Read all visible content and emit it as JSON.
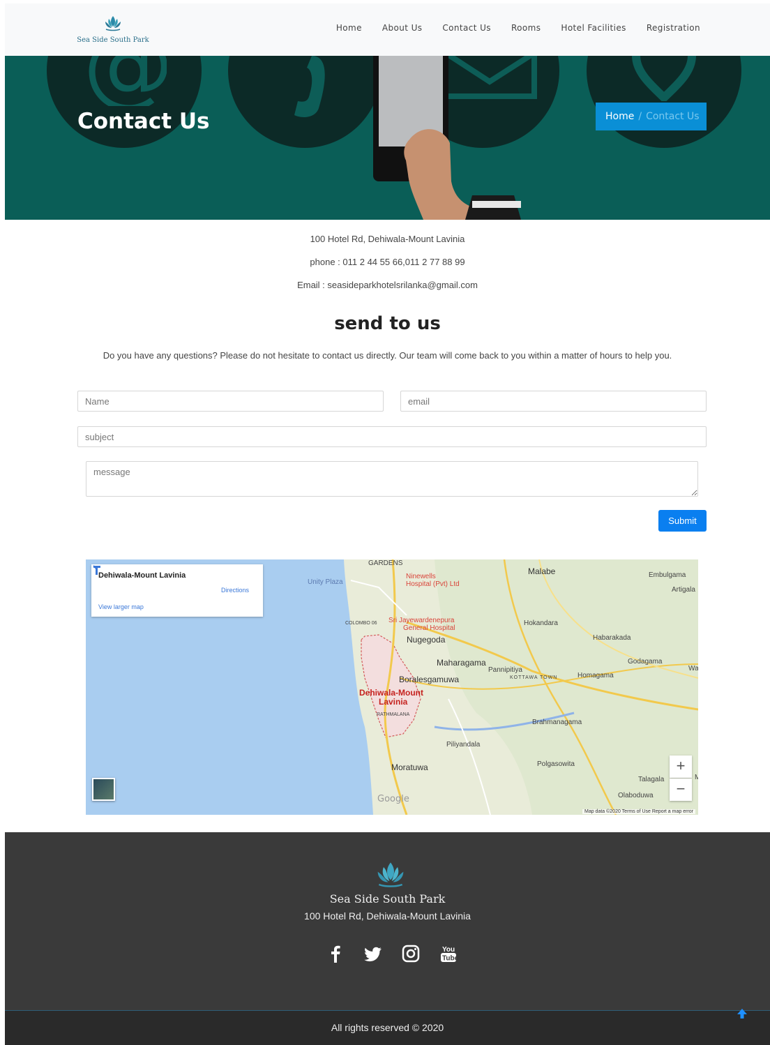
{
  "brand": {
    "name": "Sea Side South Park"
  },
  "nav": {
    "items": [
      "Home",
      "About Us",
      "Contact Us",
      "Rooms",
      "Hotel Facilities",
      "Registration"
    ]
  },
  "hero": {
    "title": "Contact Us",
    "breadcrumb": {
      "home": "Home",
      "separator": "/",
      "current": "Contact Us"
    },
    "colors": {
      "background": "#0a5e57",
      "circles": "#0c2a27",
      "badge": "#0a8fd6"
    }
  },
  "contact": {
    "address": "100 Hotel Rd, Dehiwala-Mount Lavinia",
    "phone": "phone : 011 2 44 55 66,011 2 77 88 99",
    "email": "Email : seasideparkhotelsrilanka@gmail.com"
  },
  "form": {
    "title": "send to us",
    "intro": "Do you have any questions? Please do not hesitate to contact us directly. Our team will come back to you within a matter of hours to help you.",
    "name_placeholder": "Name",
    "email_placeholder": "email",
    "subject_placeholder": "subject",
    "message_placeholder": "message",
    "submit_label": "Submit"
  },
  "map": {
    "place_title": "Dehiwala-Mount Lavinia",
    "directions_label": "Directions",
    "larger_map_label": "View larger map",
    "zoom_in": "+",
    "zoom_out": "−",
    "logo": "Google",
    "attribution": "Map data ©2020   Terms of Use   Report a map error",
    "labels": {
      "unity_plaza": "Unity Plaza",
      "ninewells": "Ninewells",
      "ninewells_2": "Hospital (Pvt) Ltd",
      "colombo": "COLOMBO 06",
      "jayawardenepura": "Sri Jayewardenepura",
      "jayawardenepura_2": "General Hospital",
      "nugegoda": "Nugegoda",
      "maharagama": "Maharagama",
      "pannipitiya": "Pannipitiya",
      "kottawa": "KOTTAWA TOWN",
      "boralesgamuwa": "Boralesgamuwa",
      "dehiwala": "Dehiwala-Mount",
      "dehiwala_2": "Lavinia",
      "rathmalana": "RATHMALANA",
      "piliyandala": "Piliyandala",
      "moratuwa": "Moratuwa",
      "polgasowita": "Polgasowita",
      "malabe": "Malabe",
      "hokandara": "Hokandara",
      "habarakada": "Habarakada",
      "homagama": "Homagama",
      "godagama": "Godagama",
      "brahmanagama": "Brahmanagama",
      "embulgama": "Embulgama",
      "artigala": "Artigala",
      "talagala": "Talagala",
      "olaboduwa": "Olaboduwa",
      "gardens": "GARDENS",
      "wa": "Wa",
      "m": "M"
    }
  },
  "footer": {
    "name": "Sea Side South Park",
    "address": "100 Hotel Rd, Dehiwala-Mount Lavinia",
    "social": [
      "facebook-icon",
      "twitter-icon",
      "instagram-icon",
      "youtube-icon"
    ],
    "copyright": "All rights reserved © 2020"
  }
}
